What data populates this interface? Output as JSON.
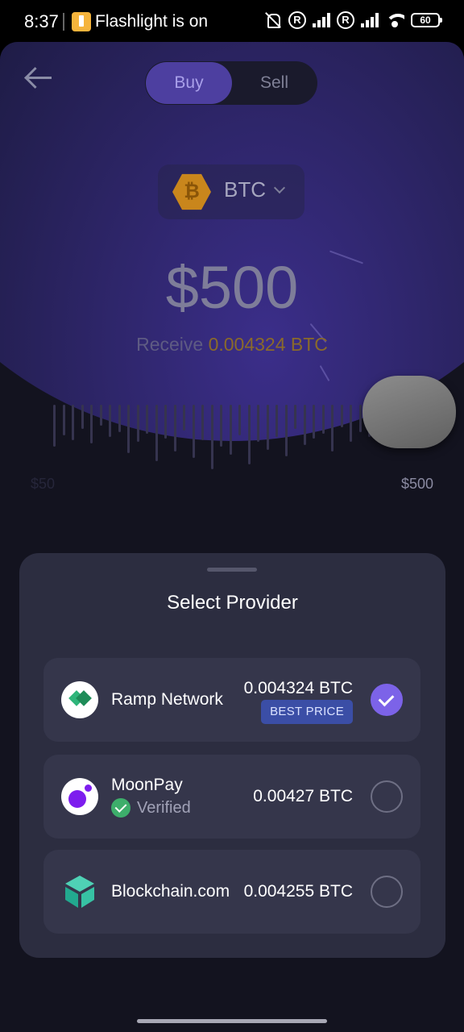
{
  "status_bar": {
    "time": "8:37",
    "notification": "Flashlight is on",
    "battery": "60"
  },
  "header": {
    "tabs": [
      {
        "label": "Buy",
        "selected": true
      },
      {
        "label": "Sell",
        "selected": false
      }
    ]
  },
  "asset": {
    "symbol": "BTC",
    "icon": "bitcoin-icon"
  },
  "amount": {
    "value": "$500",
    "receive_label": "Receive",
    "receive_value": "0.004324 BTC"
  },
  "slider": {
    "min_label": "$50",
    "max_label": "$500",
    "level": 1.0
  },
  "sheet": {
    "title": "Select Provider",
    "providers": [
      {
        "name": "Ramp Network",
        "amount": "0.004324 BTC",
        "badge": "BEST PRICE",
        "selected": true,
        "icon": "ramp-network-icon"
      },
      {
        "name": "MoonPay",
        "amount": "0.00427 BTC",
        "verified": "Verified",
        "selected": false,
        "icon": "moonpay-icon"
      },
      {
        "name": "Blockchain.com",
        "amount": "0.004255 BTC",
        "selected": false,
        "icon": "blockchain-com-icon"
      }
    ]
  },
  "colors": {
    "accent": "#7c63e8",
    "badge": "#3b4ea6",
    "verified": "#3dae6b",
    "receive_value": "#8a6a2a"
  }
}
